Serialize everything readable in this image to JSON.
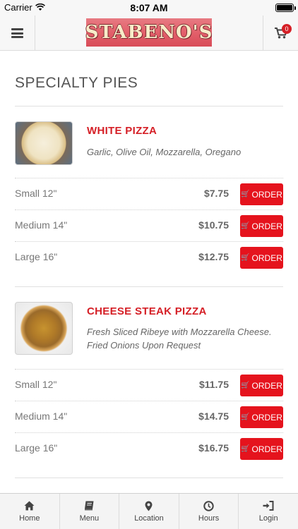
{
  "status_bar": {
    "carrier": "Carrier",
    "time": "8:07 AM"
  },
  "header": {
    "logo_text": "STABENO'S",
    "cart_count": "0"
  },
  "section": {
    "title": "SPECIALTY PIES"
  },
  "order_label": "ORDER",
  "items": [
    {
      "name": "WHITE PIZZA",
      "description": "Garlic, Olive Oil, Mozzarella, Oregano",
      "sizes": [
        {
          "label": "Small 12\"",
          "price": "$7.75"
        },
        {
          "label": "Medium 14\"",
          "price": "$10.75"
        },
        {
          "label": "Large 16\"",
          "price": "$12.75"
        }
      ]
    },
    {
      "name": "CHEESE STEAK PIZZA",
      "description": "Fresh Sliced Ribeye with Mozzarella Cheese. Fried Onions Upon Request",
      "sizes": [
        {
          "label": "Small 12\"",
          "price": "$11.75"
        },
        {
          "label": "Medium 14\"",
          "price": "$14.75"
        },
        {
          "label": "Large 16\"",
          "price": "$16.75"
        }
      ]
    }
  ],
  "tabs": [
    {
      "label": "Home",
      "icon": "home-icon"
    },
    {
      "label": "Menu",
      "icon": "book-icon"
    },
    {
      "label": "Location",
      "icon": "map-pin-icon"
    },
    {
      "label": "Hours",
      "icon": "clock-icon"
    },
    {
      "label": "Login",
      "icon": "login-icon"
    }
  ],
  "colors": {
    "accent": "#e5131d",
    "item_name": "#d51f26",
    "logo_bg": "#e25e69"
  }
}
